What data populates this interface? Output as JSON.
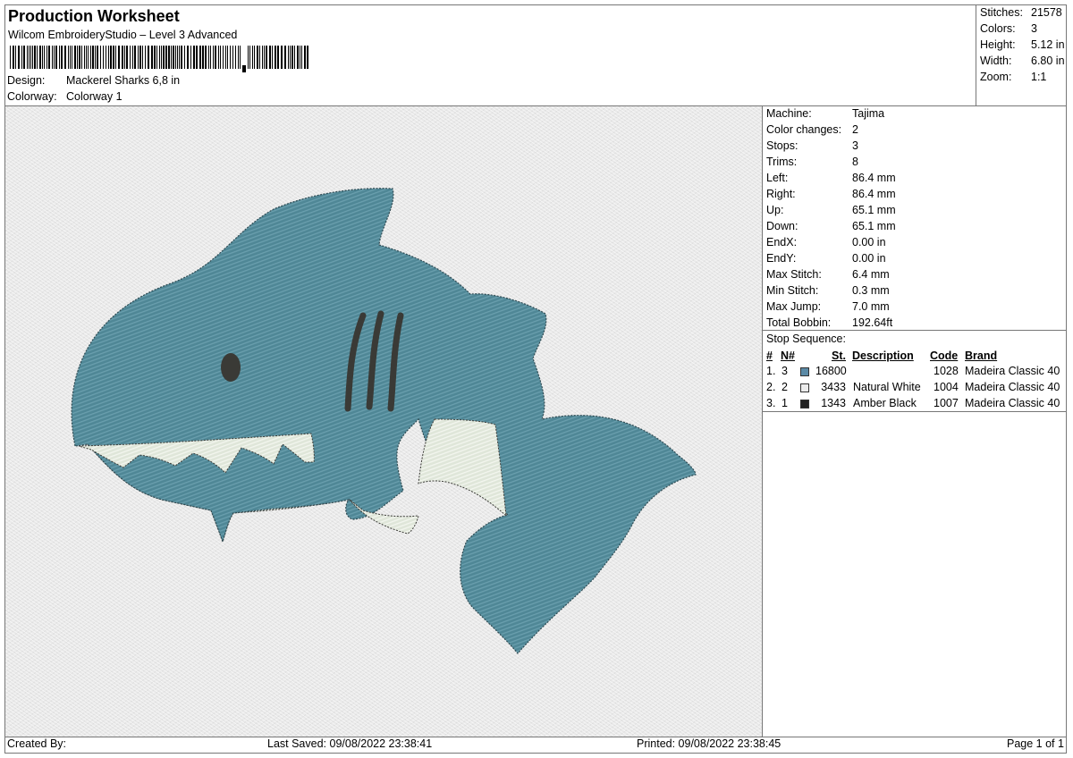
{
  "header": {
    "title": "Production Worksheet",
    "subtitle": "Wilcom EmbroideryStudio – Level 3 Advanced",
    "design_label": "Design:",
    "design_value": "Mackerel Sharks 6,8 in",
    "colorway_label": "Colorway:",
    "colorway_value": "Colorway 1"
  },
  "stats": [
    {
      "label": "Stitches:",
      "value": "21578"
    },
    {
      "label": "Colors:",
      "value": "3"
    },
    {
      "label": "Height:",
      "value": "5.12 in"
    },
    {
      "label": "Width:",
      "value": "6.80 in"
    },
    {
      "label": "Zoom:",
      "value": "1:1"
    }
  ],
  "machine_info": [
    {
      "label": "Machine:",
      "value": "Tajima"
    },
    {
      "label": "Color changes:",
      "value": "2"
    },
    {
      "label": "Stops:",
      "value": "3"
    },
    {
      "label": "Trims:",
      "value": "8"
    },
    {
      "label": "Left:",
      "value": "86.4 mm"
    },
    {
      "label": "Right:",
      "value": "86.4 mm"
    },
    {
      "label": "Up:",
      "value": "65.1 mm"
    },
    {
      "label": "Down:",
      "value": "65.1 mm"
    },
    {
      "label": "EndX:",
      "value": "0.00 in"
    },
    {
      "label": "EndY:",
      "value": "0.00 in"
    },
    {
      "label": "Max Stitch:",
      "value": "6.4 mm"
    },
    {
      "label": "Min Stitch:",
      "value": "0.3 mm"
    },
    {
      "label": "Max Jump:",
      "value": "7.0 mm"
    },
    {
      "label": "Total Bobbin:",
      "value": "192.64ft"
    }
  ],
  "stop_sequence": {
    "title": "Stop Sequence:",
    "headers": {
      "num": "#",
      "n": "N#",
      "st": "St.",
      "description": "Description",
      "code": "Code",
      "brand": "Brand"
    },
    "rows": [
      {
        "num": "1.",
        "n": "3",
        "swatch": "#5b8aa6",
        "st": "16800",
        "description": "",
        "code": "1028",
        "brand": "Madeira Classic 40"
      },
      {
        "num": "2.",
        "n": "2",
        "swatch": "#ececec",
        "st": "3433",
        "description": "Natural White",
        "code": "1004",
        "brand": "Madeira Classic 40"
      },
      {
        "num": "3.",
        "n": "1",
        "swatch": "#222222",
        "st": "1343",
        "description": "Amber Black",
        "code": "1007",
        "brand": "Madeira Classic 40"
      }
    ]
  },
  "footer": {
    "created_by": "Created By:",
    "last_saved": "Last Saved: 09/08/2022 23:38:41",
    "printed": "Printed: 09/08/2022 23:38:45",
    "page": "Page 1 of 1"
  },
  "colors": {
    "shark_body": "#4f8796",
    "shark_belly": "#dfe6d9",
    "shark_dark": "#3a3a36",
    "canvas_bg": "#e9e9e9"
  }
}
